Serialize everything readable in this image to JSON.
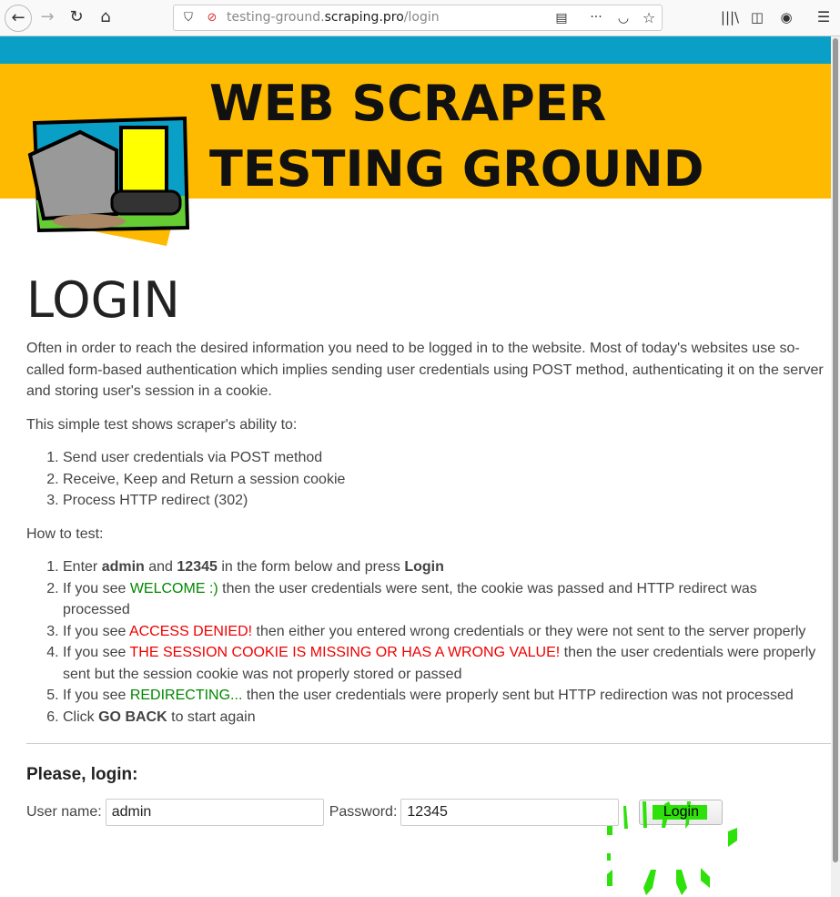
{
  "browser": {
    "url_prefix": "testing-ground.",
    "url_domain": "scraping.pro",
    "url_path": "/login"
  },
  "header": {
    "title": "WEB SCRAPER TESTING GROUND"
  },
  "main": {
    "heading": "LOGIN",
    "intro": "Often in order to reach the desired information you need to be logged in to the website. Most of today's websites use so-called form-based authentication which implies sending user credentials using POST method, authenticating it on the server and storing user's session in a cookie.",
    "abilities_intro": "This simple test shows scraper's ability to:",
    "abilities": [
      "Send user credentials via POST method",
      "Receive, Keep and Return a session cookie",
      "Process HTTP redirect (302)"
    ],
    "howto_intro": "How to test:",
    "steps": {
      "s1": {
        "a": "Enter ",
        "b1": "admin",
        "c": " and ",
        "b2": "12345",
        "d": " in the form below and press ",
        "b3": "Login"
      },
      "s2": {
        "a": "If you see ",
        "hl": "WELCOME :)",
        "b": " then the user credentials were sent, the cookie was passed and HTTP redirect was processed"
      },
      "s3": {
        "a": "If you see ",
        "hl": "ACCESS DENIED!",
        "b": " then either you entered wrong credentials or they were not sent to the server properly"
      },
      "s4": {
        "a": "If you see ",
        "hl": "THE SESSION COOKIE IS MISSING OR HAS A WRONG VALUE!",
        "b": " then the user credentials were properly sent but the session cookie was not properly stored or passed"
      },
      "s5": {
        "a": "If you see ",
        "hl": "REDIRECTING...",
        "b": " then the user credentials were properly sent but HTTP redirection was not processed"
      },
      "s6": {
        "a": "Click ",
        "b1": "GO BACK",
        "b": " to start again"
      }
    }
  },
  "form": {
    "heading": "Please, login:",
    "username_label": "User name:",
    "username_value": "admin",
    "password_label": "Password:",
    "password_value": "12345",
    "submit_label": "Login"
  },
  "colors": {
    "teal": "#0a9fc6",
    "yellow": "#fdba00",
    "success": "#008800",
    "error": "#ee0000",
    "click_marker": "#2ee10a"
  }
}
